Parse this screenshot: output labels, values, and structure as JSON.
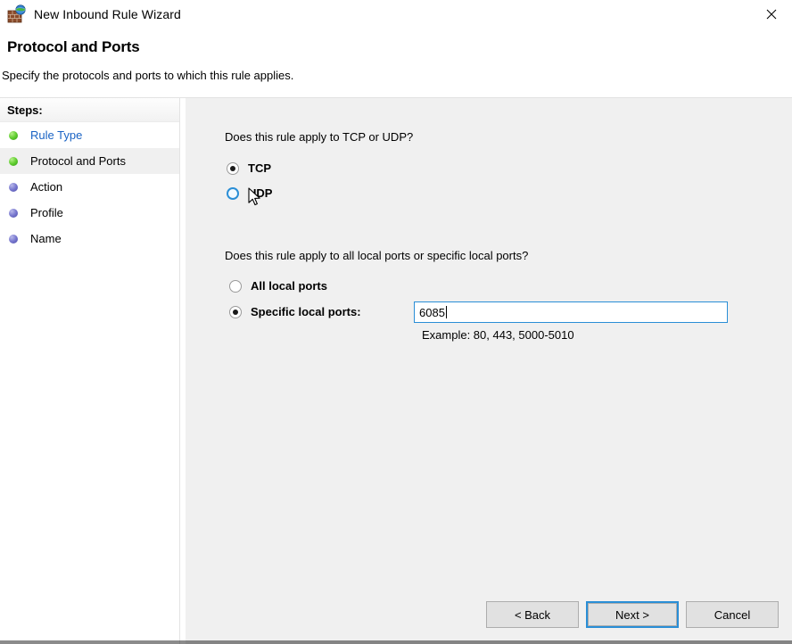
{
  "window": {
    "title": "New Inbound Rule Wizard",
    "icon": "firewall-brick-wall-globe-icon",
    "close_label": "✕"
  },
  "header": {
    "title": "Protocol and Ports",
    "subtitle": "Specify the protocols and ports to which this rule applies."
  },
  "sidebar": {
    "heading": "Steps:",
    "items": [
      {
        "label": "Rule Type",
        "state": "done",
        "style": "link"
      },
      {
        "label": "Protocol and Ports",
        "state": "done",
        "style": "current"
      },
      {
        "label": "Action",
        "state": "todo",
        "style": "normal"
      },
      {
        "label": "Profile",
        "state": "todo",
        "style": "normal"
      },
      {
        "label": "Name",
        "state": "todo",
        "style": "normal"
      }
    ]
  },
  "main": {
    "protocol_question": "Does this rule apply to TCP or UDP?",
    "protocol_options": [
      {
        "label": "TCP",
        "checked": true,
        "hover": false
      },
      {
        "label": "UDP",
        "checked": false,
        "hover": true
      }
    ],
    "ports_question": "Does this rule apply to all local ports or specific local ports?",
    "ports_options": [
      {
        "label": "All local ports",
        "checked": false
      },
      {
        "label": "Specific local ports:",
        "checked": true
      }
    ],
    "port_input": {
      "value": "6085",
      "placeholder": ""
    },
    "example_text": "Example: 80, 443, 5000-5010"
  },
  "buttons": {
    "back": "< Back",
    "next": "Next >",
    "cancel": "Cancel"
  },
  "colors": {
    "accent": "#2a8ed6",
    "link": "#1a63c4",
    "panel": "#f0f0f0",
    "button": "#e1e1e1",
    "step_done": "#63cf32",
    "step_todo": "#7a7ad0"
  }
}
